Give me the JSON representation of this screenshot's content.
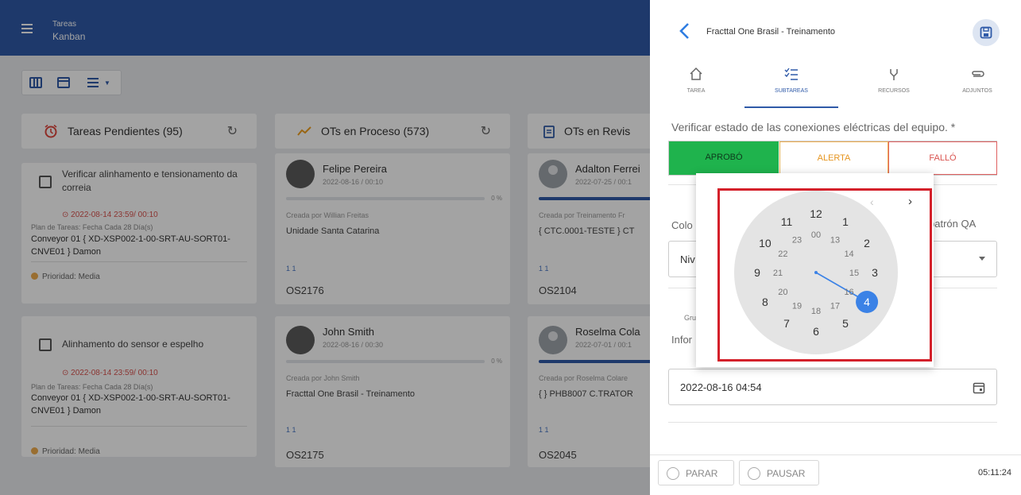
{
  "app": {
    "breadcrumb_top": "Tareas",
    "breadcrumb_view": "Kanban"
  },
  "columns": [
    {
      "title": "Tareas Pendientes (95)",
      "icon": "alarm-icon"
    },
    {
      "title": "OTs en Proceso (573)",
      "icon": "trend-icon"
    },
    {
      "title": "OTs en Revis",
      "icon": "clipboard-icon"
    }
  ],
  "pending_cards": [
    {
      "title": "Verificar alinhamento e tensionamento da correia",
      "date": "2022-08-14 23:59/ 00:10",
      "plan": "Plan de Tareas: Fecha Cada 28 Día(s)",
      "equipment": "Conveyor 01 { XD-XSP002-1-00-SRT-AU-SORT01-CNVE01 } Damon",
      "priority": "Prioridad: Media"
    },
    {
      "title": "Alinhamento do sensor e espelho",
      "date": "2022-08-14 23:59/ 00:10",
      "plan": "Plan de Tareas: Fecha Cada 28 Día(s)",
      "equipment": "Conveyor 01 { XD-XSP002-1-00-SRT-AU-SORT01-CNVE01 } Damon",
      "priority": "Prioridad: Media"
    }
  ],
  "process_cards": [
    {
      "user": "Felipe Pereira",
      "date": "2022-08-16 / 00:10",
      "progress": 0,
      "progress_label": "0 %",
      "created_by": "Creada por Willian Freitas",
      "site": "Unidade Santa Catarina",
      "counts": "1  1",
      "code": "OS2176"
    },
    {
      "user": "John Smith",
      "date": "2022-08-16 / 00:30",
      "progress": 0,
      "progress_label": "0 %",
      "created_by": "Creada por John Smith",
      "site": "Fracttal One Brasil - Treinamento",
      "counts": "1  1",
      "code": "OS2175"
    }
  ],
  "review_cards": [
    {
      "user": "Adalton Ferrei",
      "date": "2022-07-25 / 00:1",
      "created_by": "Creada por Treinamento Fr",
      "site": "{ CTC.0001-TESTE } CT",
      "counts": "1  1",
      "code": "OS2104"
    },
    {
      "user": "Roselma Cola",
      "date": "2022-07-01 / 00:1",
      "created_by": "Creada por Roselma Colare",
      "site": "{ } PHB8007 C.TRATOR",
      "counts": "1  1",
      "code": "OS2045"
    }
  ],
  "panel": {
    "title": "Fracttal One Brasil - Treinamento",
    "tabs": [
      {
        "label": "TAREA",
        "icon": "home-icon",
        "active": false
      },
      {
        "label": "SUBTAREAS",
        "icon": "checklist-icon",
        "active": true
      },
      {
        "label": "RECURSOS",
        "icon": "tools-icon",
        "active": false
      },
      {
        "label": "ADJUNTOS",
        "icon": "paperclip-icon",
        "active": false
      }
    ],
    "question": "Verificar estado de las conexiones eléctricas del equipo. *",
    "options": {
      "approve": "APROBÓ",
      "alert": "ALERTA",
      "fail": "FALLÓ"
    },
    "field1_label_left": "Colo",
    "field1_label_right": "patrón QA",
    "field1_value": "Niv",
    "group_label": "Gru",
    "info_label": "Infor",
    "datetime_value": "2022-08-16 04:54",
    "stop_label": "PARAR",
    "pause_label": "PAUSAR",
    "timer": "05:11:24"
  },
  "clock": {
    "outer": [
      "12",
      "1",
      "2",
      "3",
      "4",
      "5",
      "6",
      "7",
      "8",
      "9",
      "10",
      "11"
    ],
    "inner": [
      "00",
      "13",
      "14",
      "15",
      "16",
      "17",
      "18",
      "19",
      "20",
      "21",
      "22",
      "23"
    ],
    "selected_hour": 4,
    "accent": "#3b82e6"
  },
  "colors": {
    "header": "#2f5aa8",
    "approve": "#1fb34d",
    "alert": "#f0ad4e",
    "fail": "#d9534f",
    "highlight": "#d4202a"
  }
}
